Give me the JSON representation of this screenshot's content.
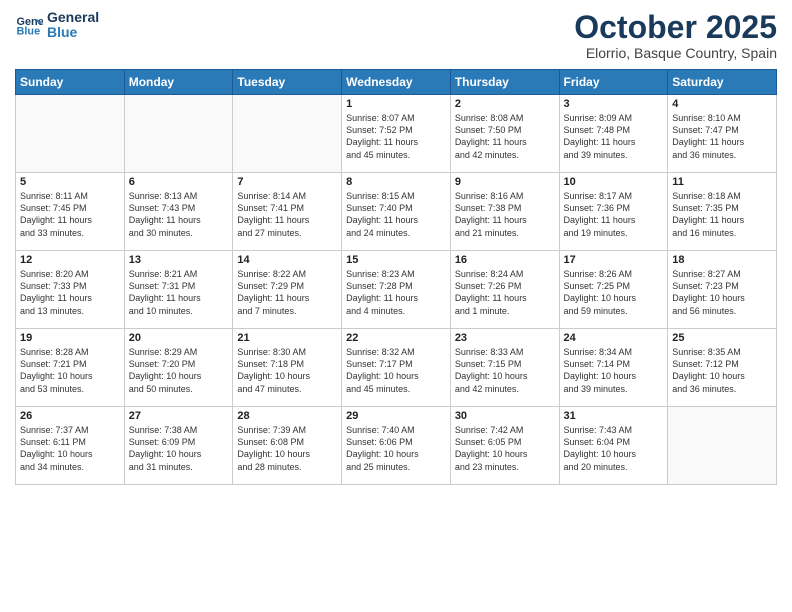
{
  "header": {
    "logo_line1": "General",
    "logo_line2": "Blue",
    "month": "October 2025",
    "location": "Elorrio, Basque Country, Spain"
  },
  "weekdays": [
    "Sunday",
    "Monday",
    "Tuesday",
    "Wednesday",
    "Thursday",
    "Friday",
    "Saturday"
  ],
  "weeks": [
    [
      {
        "day": "",
        "info": ""
      },
      {
        "day": "",
        "info": ""
      },
      {
        "day": "",
        "info": ""
      },
      {
        "day": "1",
        "info": "Sunrise: 8:07 AM\nSunset: 7:52 PM\nDaylight: 11 hours\nand 45 minutes."
      },
      {
        "day": "2",
        "info": "Sunrise: 8:08 AM\nSunset: 7:50 PM\nDaylight: 11 hours\nand 42 minutes."
      },
      {
        "day": "3",
        "info": "Sunrise: 8:09 AM\nSunset: 7:48 PM\nDaylight: 11 hours\nand 39 minutes."
      },
      {
        "day": "4",
        "info": "Sunrise: 8:10 AM\nSunset: 7:47 PM\nDaylight: 11 hours\nand 36 minutes."
      }
    ],
    [
      {
        "day": "5",
        "info": "Sunrise: 8:11 AM\nSunset: 7:45 PM\nDaylight: 11 hours\nand 33 minutes."
      },
      {
        "day": "6",
        "info": "Sunrise: 8:13 AM\nSunset: 7:43 PM\nDaylight: 11 hours\nand 30 minutes."
      },
      {
        "day": "7",
        "info": "Sunrise: 8:14 AM\nSunset: 7:41 PM\nDaylight: 11 hours\nand 27 minutes."
      },
      {
        "day": "8",
        "info": "Sunrise: 8:15 AM\nSunset: 7:40 PM\nDaylight: 11 hours\nand 24 minutes."
      },
      {
        "day": "9",
        "info": "Sunrise: 8:16 AM\nSunset: 7:38 PM\nDaylight: 11 hours\nand 21 minutes."
      },
      {
        "day": "10",
        "info": "Sunrise: 8:17 AM\nSunset: 7:36 PM\nDaylight: 11 hours\nand 19 minutes."
      },
      {
        "day": "11",
        "info": "Sunrise: 8:18 AM\nSunset: 7:35 PM\nDaylight: 11 hours\nand 16 minutes."
      }
    ],
    [
      {
        "day": "12",
        "info": "Sunrise: 8:20 AM\nSunset: 7:33 PM\nDaylight: 11 hours\nand 13 minutes."
      },
      {
        "day": "13",
        "info": "Sunrise: 8:21 AM\nSunset: 7:31 PM\nDaylight: 11 hours\nand 10 minutes."
      },
      {
        "day": "14",
        "info": "Sunrise: 8:22 AM\nSunset: 7:29 PM\nDaylight: 11 hours\nand 7 minutes."
      },
      {
        "day": "15",
        "info": "Sunrise: 8:23 AM\nSunset: 7:28 PM\nDaylight: 11 hours\nand 4 minutes."
      },
      {
        "day": "16",
        "info": "Sunrise: 8:24 AM\nSunset: 7:26 PM\nDaylight: 11 hours\nand 1 minute."
      },
      {
        "day": "17",
        "info": "Sunrise: 8:26 AM\nSunset: 7:25 PM\nDaylight: 10 hours\nand 59 minutes."
      },
      {
        "day": "18",
        "info": "Sunrise: 8:27 AM\nSunset: 7:23 PM\nDaylight: 10 hours\nand 56 minutes."
      }
    ],
    [
      {
        "day": "19",
        "info": "Sunrise: 8:28 AM\nSunset: 7:21 PM\nDaylight: 10 hours\nand 53 minutes."
      },
      {
        "day": "20",
        "info": "Sunrise: 8:29 AM\nSunset: 7:20 PM\nDaylight: 10 hours\nand 50 minutes."
      },
      {
        "day": "21",
        "info": "Sunrise: 8:30 AM\nSunset: 7:18 PM\nDaylight: 10 hours\nand 47 minutes."
      },
      {
        "day": "22",
        "info": "Sunrise: 8:32 AM\nSunset: 7:17 PM\nDaylight: 10 hours\nand 45 minutes."
      },
      {
        "day": "23",
        "info": "Sunrise: 8:33 AM\nSunset: 7:15 PM\nDaylight: 10 hours\nand 42 minutes."
      },
      {
        "day": "24",
        "info": "Sunrise: 8:34 AM\nSunset: 7:14 PM\nDaylight: 10 hours\nand 39 minutes."
      },
      {
        "day": "25",
        "info": "Sunrise: 8:35 AM\nSunset: 7:12 PM\nDaylight: 10 hours\nand 36 minutes."
      }
    ],
    [
      {
        "day": "26",
        "info": "Sunrise: 7:37 AM\nSunset: 6:11 PM\nDaylight: 10 hours\nand 34 minutes."
      },
      {
        "day": "27",
        "info": "Sunrise: 7:38 AM\nSunset: 6:09 PM\nDaylight: 10 hours\nand 31 minutes."
      },
      {
        "day": "28",
        "info": "Sunrise: 7:39 AM\nSunset: 6:08 PM\nDaylight: 10 hours\nand 28 minutes."
      },
      {
        "day": "29",
        "info": "Sunrise: 7:40 AM\nSunset: 6:06 PM\nDaylight: 10 hours\nand 25 minutes."
      },
      {
        "day": "30",
        "info": "Sunrise: 7:42 AM\nSunset: 6:05 PM\nDaylight: 10 hours\nand 23 minutes."
      },
      {
        "day": "31",
        "info": "Sunrise: 7:43 AM\nSunset: 6:04 PM\nDaylight: 10 hours\nand 20 minutes."
      },
      {
        "day": "",
        "info": ""
      }
    ]
  ]
}
